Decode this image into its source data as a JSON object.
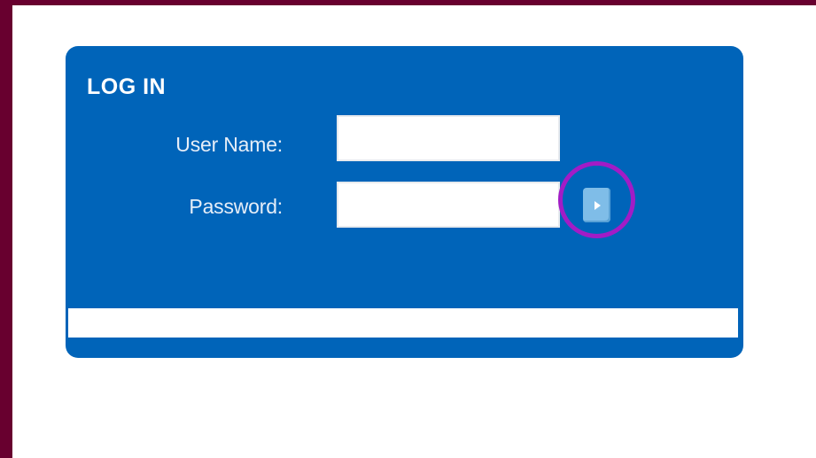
{
  "login": {
    "title": "LOG IN",
    "username_label": "User Name:",
    "username_value": "",
    "password_label": "Password:",
    "password_value": "",
    "submit_icon": "play-arrow-icon",
    "highlight": "highlight-circle"
  },
  "colors": {
    "page_border": "#68002f",
    "panel": "#0064b9",
    "submit_button": "#7fbde8",
    "highlight_ring": "#a21cc6"
  }
}
